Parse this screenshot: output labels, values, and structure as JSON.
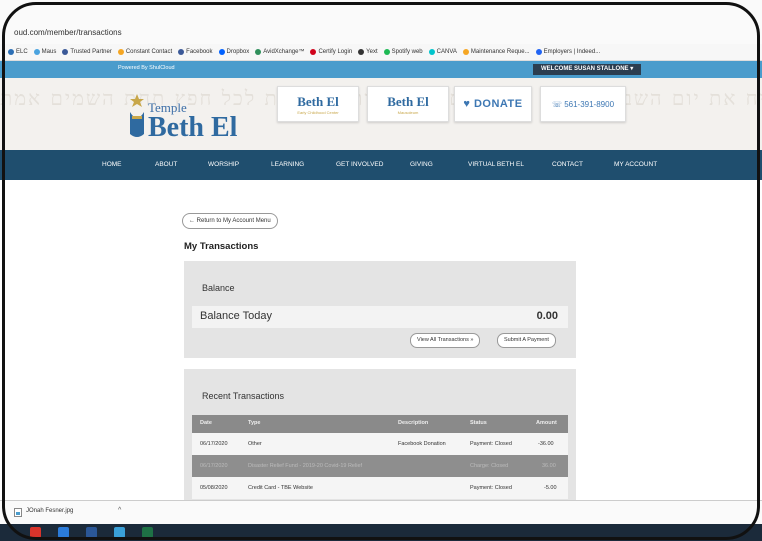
{
  "browser": {
    "url": "oud.com/member/transactions",
    "bookmarks": [
      {
        "label": "ELC",
        "color": "#2c6fb5"
      },
      {
        "label": "Maus",
        "color": "#4aa3df"
      },
      {
        "label": "Trusted Partner",
        "color": "#3b5998"
      },
      {
        "label": "Constant Contact",
        "color": "#f5a623"
      },
      {
        "label": "Facebook",
        "color": "#3b5998"
      },
      {
        "label": "Dropbox",
        "color": "#0061ff"
      },
      {
        "label": "AvidXchange™",
        "color": "#2f8f5b"
      },
      {
        "label": "Certify Login",
        "color": "#d0021b"
      },
      {
        "label": "Yext",
        "color": "#333333"
      },
      {
        "label": "Spotify web",
        "color": "#1db954"
      },
      {
        "label": "CANVA",
        "color": "#00c4cc"
      },
      {
        "label": "Maintenance Reque...",
        "color": "#f5a623"
      },
      {
        "label": "Employers | Indeed...",
        "color": "#2164f3"
      }
    ]
  },
  "site": {
    "powered_by": "Powered By ShulCloud",
    "welcome": "WELCOME SUSAN STALLONE ▾",
    "hebrew_bg": "יח את יום השבת לקדשו אלה ויום הזה מצות יהיה עת לכל חפץ תחת השמים אמת",
    "logo_top": "Temple",
    "logo_main": "Beth El",
    "header_boxes": {
      "ecc_title": "Beth El",
      "ecc_sub": "Early Childhood Center",
      "mausoleum_title": "Beth El",
      "mausoleum_sub": "Mausoleum",
      "donate": "♥ DONATE",
      "phone": "☏ 561-391-8900"
    },
    "nav": [
      "HOME",
      "ABOUT",
      "WORSHIP",
      "LEARNING",
      "GET INVOLVED",
      "GIVING",
      "VIRTUAL BETH EL",
      "CONTACT",
      "MY ACCOUNT"
    ]
  },
  "page": {
    "back_button": "← Return to My Account Menu",
    "title": "My Transactions",
    "balance": {
      "section_title": "Balance",
      "label": "Balance Today",
      "value": "0.00",
      "view_all": "View All Transactions »",
      "submit_payment": "Submit A Payment"
    },
    "recent": {
      "section_title": "Recent Transactions",
      "columns": [
        "Date",
        "Type",
        "Description",
        "Status",
        "Amount"
      ],
      "rows": [
        {
          "date": "06/17/2020",
          "type": "Other",
          "description": "Facebook Donation",
          "status": "Payment: Closed",
          "amount": "-36.00"
        },
        {
          "date": "06/17/2020",
          "type": "Disaster Relief Fund - 2019-20 Covid-19 Relief",
          "description": "",
          "status": "Charge: Closed",
          "amount": "36.00"
        },
        {
          "date": "05/08/2020",
          "type": "Credit Card - TBE Website",
          "description": "",
          "status": "Payment: Closed",
          "amount": "-5.00"
        }
      ]
    }
  },
  "downloads": {
    "file": "JOnah Fesner.jpg",
    "chevron": "^"
  },
  "taskbar_colors": [
    "#d9342b",
    "#2b7bd9",
    "#2b5797",
    "#3aa0d8",
    "#1e7145"
  ]
}
